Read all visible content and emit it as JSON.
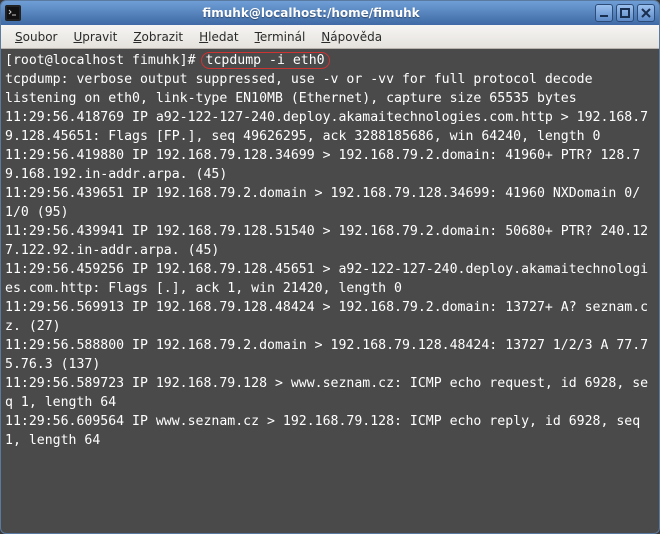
{
  "window": {
    "title": "fimuhk@localhost:/home/fimuhk"
  },
  "menubar": {
    "items": [
      {
        "underline": "S",
        "rest": "oubor"
      },
      {
        "underline": "U",
        "rest": "pravit"
      },
      {
        "underline": "Z",
        "rest": "obrazit"
      },
      {
        "underline": "H",
        "rest": "ledat"
      },
      {
        "underline": "T",
        "rest": "erminál"
      },
      {
        "underline": "N",
        "rest": "ápověda"
      }
    ]
  },
  "terminal": {
    "prompt": "[root@localhost fimuhk]# ",
    "command": "tcpdump -i eth0",
    "output": [
      "tcpdump: verbose output suppressed, use -v or -vv for full protocol decode",
      "listening on eth0, link-type EN10MB (Ethernet), capture size 65535 bytes",
      "11:29:56.418769 IP a92-122-127-240.deploy.akamaitechnologies.com.http > 192.168.79.128.45651: Flags [FP.], seq 49626295, ack 3288185686, win 64240, length 0",
      "11:29:56.419880 IP 192.168.79.128.34699 > 192.168.79.2.domain: 41960+ PTR? 128.79.168.192.in-addr.arpa. (45)",
      "11:29:56.439651 IP 192.168.79.2.domain > 192.168.79.128.34699: 41960 NXDomain 0/1/0 (95)",
      "11:29:56.439941 IP 192.168.79.128.51540 > 192.168.79.2.domain: 50680+ PTR? 240.127.122.92.in-addr.arpa. (45)",
      "11:29:56.459256 IP 192.168.79.128.45651 > a92-122-127-240.deploy.akamaitechnologies.com.http: Flags [.], ack 1, win 21420, length 0",
      "11:29:56.569913 IP 192.168.79.128.48424 > 192.168.79.2.domain: 13727+ A? seznam.cz. (27)",
      "11:29:56.588800 IP 192.168.79.2.domain > 192.168.79.128.48424: 13727 1/2/3 A 77.75.76.3 (137)",
      "11:29:56.589723 IP 192.168.79.128 > www.seznam.cz: ICMP echo request, id 6928, seq 1, length 64",
      "11:29:56.609564 IP www.seznam.cz > 192.168.79.128: ICMP echo reply, id 6928, seq 1, length 64"
    ]
  }
}
